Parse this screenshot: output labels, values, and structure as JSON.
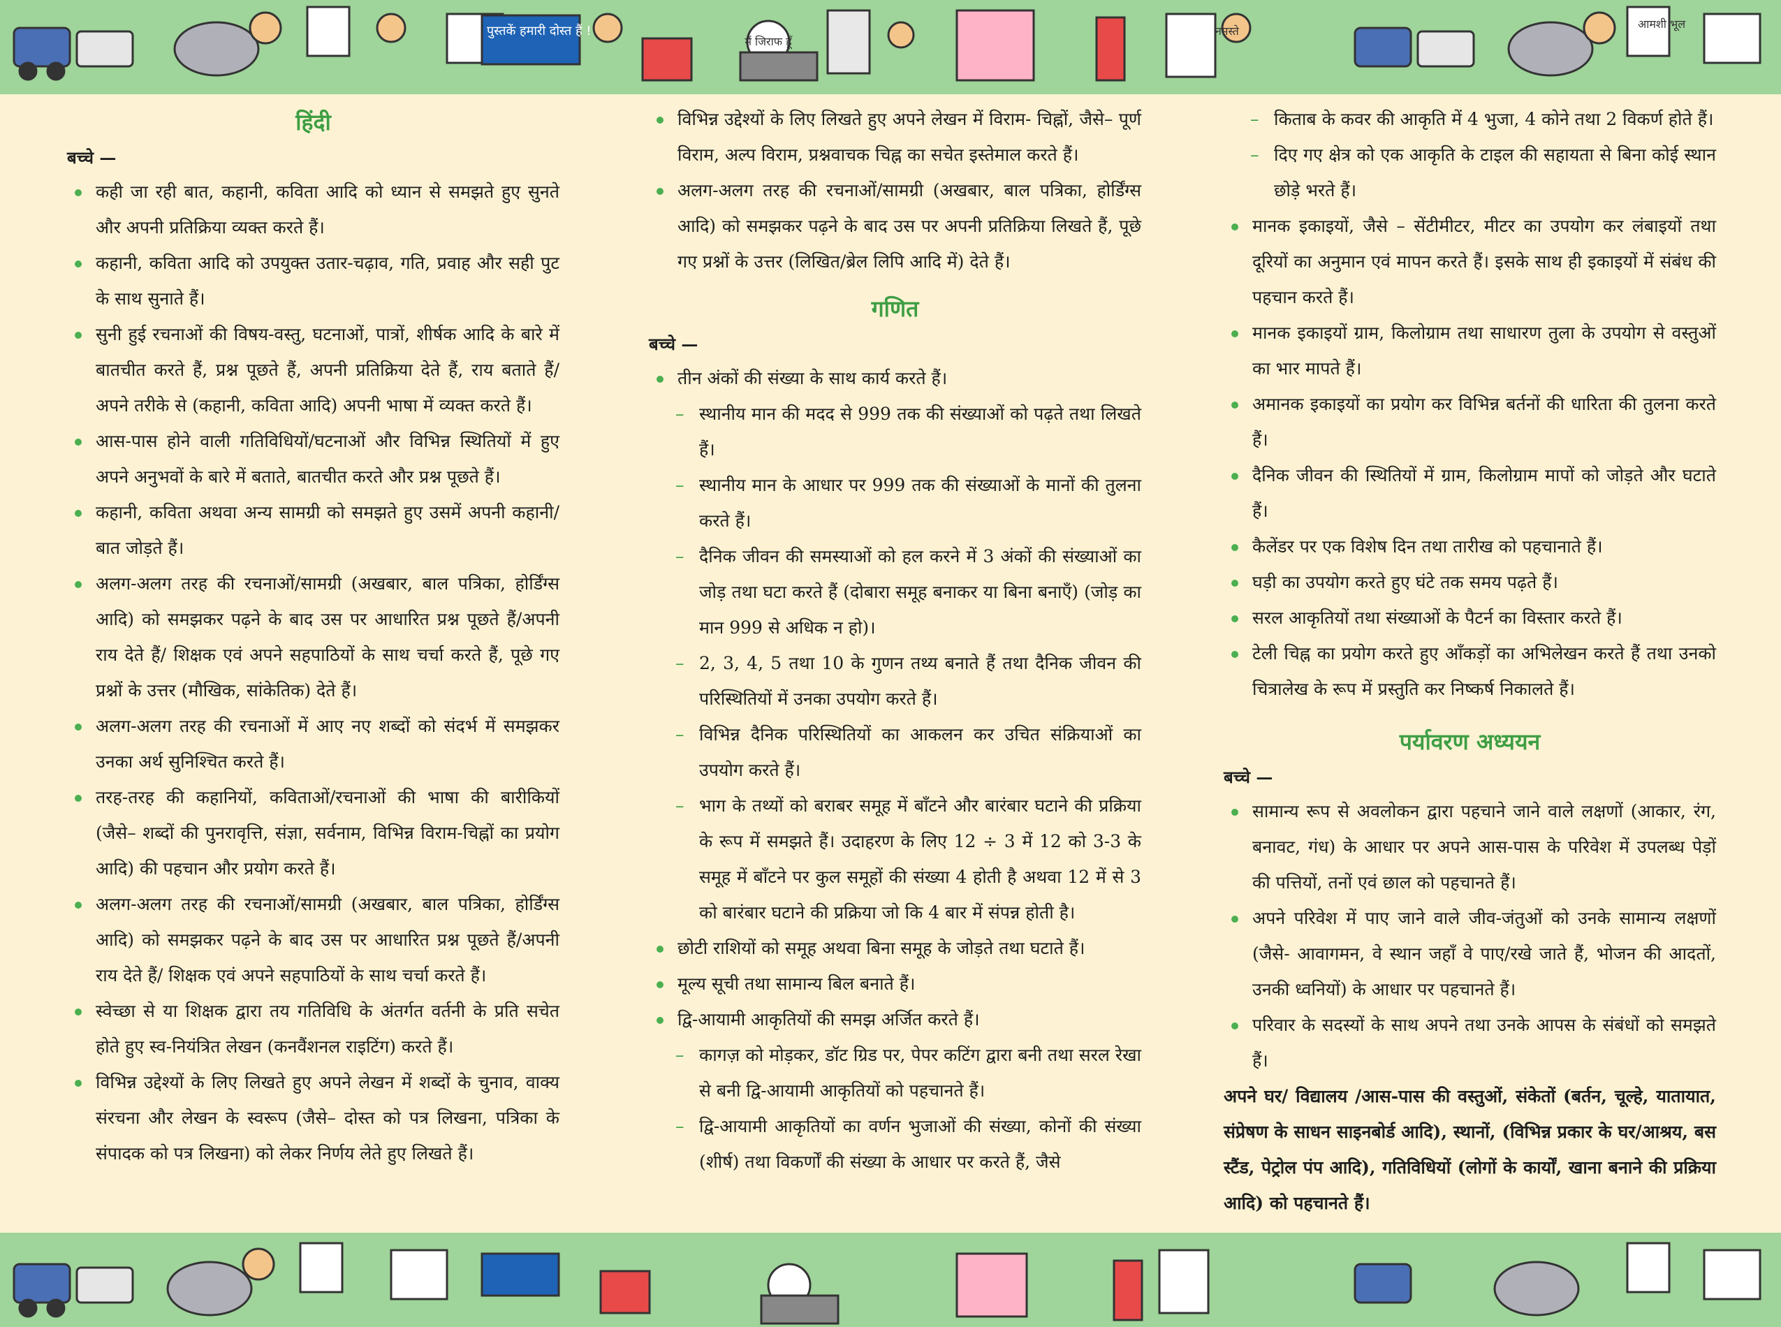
{
  "palette": {
    "background": "#fdf3d4",
    "band": "#9fd49a",
    "heading": "#3e9e44",
    "bullet": "#4caf50"
  },
  "decor": {
    "top_band_icon": "children-cartoon-illustration",
    "bottom_band_icon": "children-cartoon-illustration",
    "sign_text_1": "पुस्तकें हमारी दोस्त हैं !",
    "sign_text_2": "मैं जिराफ हूँ",
    "sign_text_3": "नमस्ते",
    "sign_text_4": "आमशी भूल"
  },
  "col1": {
    "heading": "हिंदी",
    "label": "बच्चे —",
    "items": [
      {
        "type": "bullet",
        "text": "कही जा रही बात, कहानी, कविता आदि को ध्यान से समझते हुए सुनते और अपनी प्रतिक्रिया व्यक्त करते हैं।"
      },
      {
        "type": "bullet",
        "text": "कहानी, कविता आदि को उपयुक्त उतार-चढ़ाव, गति, प्रवाह और सही पुट के साथ सुनाते हैं।"
      },
      {
        "type": "bullet",
        "text": "सुनी हुई रचनाओं की विषय-वस्तु, घटनाओं, पात्रों, शीर्षक आदि के बारे में बातचीत करते हैं, प्रश्न पूछते हैं, अपनी प्रतिक्रिया देते हैं, राय बताते हैं/अपने तरीके से (कहानी, कविता आदि) अपनी भाषा में व्यक्त करते हैं।"
      },
      {
        "type": "bullet",
        "text": "आस-पास होने वाली गतिविधियों/घटनाओं और विभिन्न स्थितियों में हुए अपने अनुभवों के बारे में बताते, बातचीत करते और प्रश्न पूछते हैं।"
      },
      {
        "type": "bullet",
        "text": "कहानी, कविता अथवा अन्य सामग्री को समझते हुए उसमें अपनी कहानी/बात जोड़ते हैं।"
      },
      {
        "type": "bullet",
        "text": "अलग-अलग तरह की रचनाओं/सामग्री (अखबार, बाल पत्रिका, होर्डिंग्स आदि) को समझकर पढ़ने के बाद उस पर आधारित प्रश्न पूछते हैं/अपनी राय देते हैं/ शिक्षक एवं अपने सहपाठियों के साथ चर्चा करते हैं, पूछे गए प्रश्नों के उत्तर (मौखिक, सांकेतिक) देते हैं।"
      },
      {
        "type": "bullet",
        "text": "अलग-अलग तरह की रचनाओं में आए नए शब्दों को संदर्भ में समझकर उनका अर्थ सुनिश्चित करते हैं।"
      },
      {
        "type": "bullet",
        "text": "तरह-तरह की कहानियों, कविताओं/रचनाओं की भाषा की बारीकियों (जैसे– शब्दों की पुनरावृत्ति, संज्ञा, सर्वनाम, विभिन्न विराम-चिह्नों का प्रयोग आदि) की पहचान और प्रयोग करते हैं।"
      },
      {
        "type": "bullet",
        "text": "अलग-अलग तरह की रचनाओं/सामग्री (अखबार, बाल पत्रिका, होर्डिंग्स आदि) को समझकर पढ़ने के बाद उस पर आधारित प्रश्न पूछते हैं/अपनी राय देते हैं/ शिक्षक एवं अपने सहपाठियों के साथ चर्चा करते हैं।"
      },
      {
        "type": "bullet",
        "text": "स्वेच्छा से या शिक्षक द्वारा तय गतिविधि के अंतर्गत वर्तनी के प्रति सचेत होते हुए स्व-नियंत्रित लेखन (कनवैंशनल राइटिंग) करते हैं।"
      },
      {
        "type": "bullet",
        "text": "विभिन्न उद्देश्यों के लिए लिखते हुए अपने लेखन में शब्दों के चुनाव, वाक्य संरचना और लेखन के स्वरूप (जैसे– दोस्त को पत्र लिखना, पत्रिका के संपादक को पत्र लिखना) को लेकर निर्णय लेते हुए लिखते हैं।"
      }
    ]
  },
  "col2": {
    "items_top": [
      {
        "type": "bullet",
        "text": "विभिन्न उद्देश्यों के लिए लिखते हुए अपने लेखन में विराम- चिह्नों, जैसे– पूर्ण विराम, अल्प विराम, प्रश्नवाचक चिह्न का सचेत इस्तेमाल करते हैं।"
      },
      {
        "type": "bullet",
        "text": "अलग-अलग तरह की रचनाओं/सामग्री (अखबार, बाल पत्रिका, होर्डिंग्स आदि) को समझकर पढ़ने के बाद उस पर अपनी प्रतिक्रिया लिखते हैं, पूछे गए प्रश्नों के उत्तर (लिखित/ब्रेल लिपि आदि में) देते हैं।"
      }
    ],
    "heading": "गणित",
    "label": "बच्चे —",
    "items": [
      {
        "type": "bullet",
        "text": "तीन अंकों की संख्या के साथ कार्य करते हैं।"
      },
      {
        "type": "dash",
        "text": "स्थानीय मान की मदद से 999 तक की संख्याओं को पढ़ते तथा लिखते हैं।"
      },
      {
        "type": "dash",
        "text": "स्थानीय मान के आधार पर 999 तक की संख्याओं के मानों की तुलना करते हैं।"
      },
      {
        "type": "dash",
        "text": "दैनिक जीवन की समस्याओं को हल करने में 3 अंकों की संख्याओं का जोड़ तथा घटा करते हैं (दोबारा समूह बनाकर या बिना बनाएँ) (जोड़ का मान 999 से अधिक न हो)।"
      },
      {
        "type": "dash",
        "text": "2, 3, 4, 5 तथा 10 के गुणन तथ्य बनाते हैं तथा दैनिक जीवन की परिस्थितियों में उनका उपयोग करते हैं।"
      },
      {
        "type": "dash",
        "text": "विभिन्न दैनिक परिस्थितियों का आकलन कर उचित संक्रियाओं का उपयोग करते हैं।"
      },
      {
        "type": "dash",
        "text": "भाग के तथ्यों को बराबर समूह में बाँटने और बारंबार घटाने की प्रक्रिया के रूप में समझते हैं। उदाहरण के लिए 12 ÷ 3 में 12 को 3-3 के समूह में बाँटने पर कुल समूहों की संख्या 4 होती है अथवा 12 में से 3 को बारंबार घटाने की प्रक्रिया जो कि 4 बार में संपन्न होती है।"
      },
      {
        "type": "bullet",
        "text": "छोटी राशियों को समूह अथवा बिना समूह के जोड़ते तथा घटाते हैं।"
      },
      {
        "type": "bullet",
        "text": "मूल्य सूची तथा सामान्य बिल बनाते हैं।"
      },
      {
        "type": "bullet",
        "text": "द्वि-आयामी आकृतियों की समझ अर्जित करते हैं।"
      },
      {
        "type": "dash",
        "text": "कागज़ को मोड़कर, डॉट ग्रिड पर, पेपर कटिंग द्वारा बनी तथा सरल रेखा से बनी द्वि-आयामी आकृतियों को पहचानते हैं।"
      },
      {
        "type": "dash",
        "text": "द्वि-आयामी आकृतियों का वर्णन भुजाओं की संख्या, कोनों की संख्या (शीर्ष) तथा विकर्णों की संख्या के आधार पर करते हैं, जैसे"
      }
    ]
  },
  "col3": {
    "items_top": [
      {
        "type": "dash",
        "text": "किताब के कवर की आकृति में 4 भुजा, 4 कोने तथा 2 विकर्ण होते हैं।"
      },
      {
        "type": "dash",
        "text": "दिए गए क्षेत्र को एक आकृति के टाइल की सहायता से बिना कोई स्थान छोड़े भरते हैं।"
      },
      {
        "type": "bullet",
        "text": "मानक इकाइयों, जैसे – सेंटीमीटर, मीटर का उपयोग कर लंबाइयों तथा दूरियों का अनुमान एवं मापन करते हैं। इसके साथ ही इकाइयों में संबंध की पहचान करते हैं।"
      },
      {
        "type": "bullet",
        "text": "मानक इकाइयों ग्राम, किलोग्राम तथा साधारण तुला के उपयोग से वस्तुओं का भार मापते हैं।"
      },
      {
        "type": "bullet",
        "text": "अमानक इकाइयों का प्रयोग कर विभिन्न बर्तनों की धारिता की तुलना करते हैं।"
      },
      {
        "type": "bullet",
        "text": "दैनिक जीवन की स्थितियों में ग्राम, किलोग्राम मापों को जोड़ते और घटाते हैं।"
      },
      {
        "type": "bullet",
        "text": "कैलेंडर पर एक विशेष दिन तथा तारीख को पहचानाते हैं।"
      },
      {
        "type": "bullet",
        "text": "घड़ी का उपयोग करते हुए घंटे तक समय पढ़ते हैं।"
      },
      {
        "type": "bullet",
        "text": "सरल आकृतियों तथा संख्याओं के पैटर्न का विस्तार करते हैं।"
      },
      {
        "type": "bullet",
        "text": "टेली चिह्न का प्रयोग करते हुए आँकड़ों का अभिलेखन करते हैं तथा उनको चित्रालेख के रूप में प्रस्तुति कर निष्कर्ष निकालते हैं।"
      }
    ],
    "heading": "पर्यावरण अध्ययन",
    "label": "बच्चे —",
    "items": [
      {
        "type": "bullet",
        "text": "सामान्य रूप से अवलोकन द्वारा पहचाने जाने वाले लक्षणों (आकार, रंग, बनावट, गंध) के आधार पर अपने आस-पास के परिवेश में उपलब्ध पेड़ों की पत्तियों, तनों एवं छाल को पहचानते हैं।"
      },
      {
        "type": "bullet",
        "text": "अपने परिवेश में पाए जाने वाले जीव-जंतुओं को उनके सामान्य लक्षणों (जैसे- आवागमन, वे स्थान जहाँ वे पाए/रखे जाते हैं, भोजन की आदतों, उनकी ध्वनियों) के आधार पर पहचानते हैं।"
      },
      {
        "type": "bullet",
        "text": "परिवार के सदस्यों के साथ अपने तथा उनके आपस के संबंधों को समझते हैं।"
      }
    ],
    "closing": "अपने घर/ विद्यालय /आस-पास की वस्तुओं, संकेतों (बर्तन, चूल्हे, यातायात, संप्रेषण के साधन साइनबोर्ड आदि), स्थानों, (विभिन्न प्रकार के घर/आश्रय, बस स्टैंड, पेट्रोल पंप आदि), गतिविधियों (लोगों के कार्यों, खाना बनाने की प्रक्रिया आदि) को पहचानते हैं।"
  }
}
